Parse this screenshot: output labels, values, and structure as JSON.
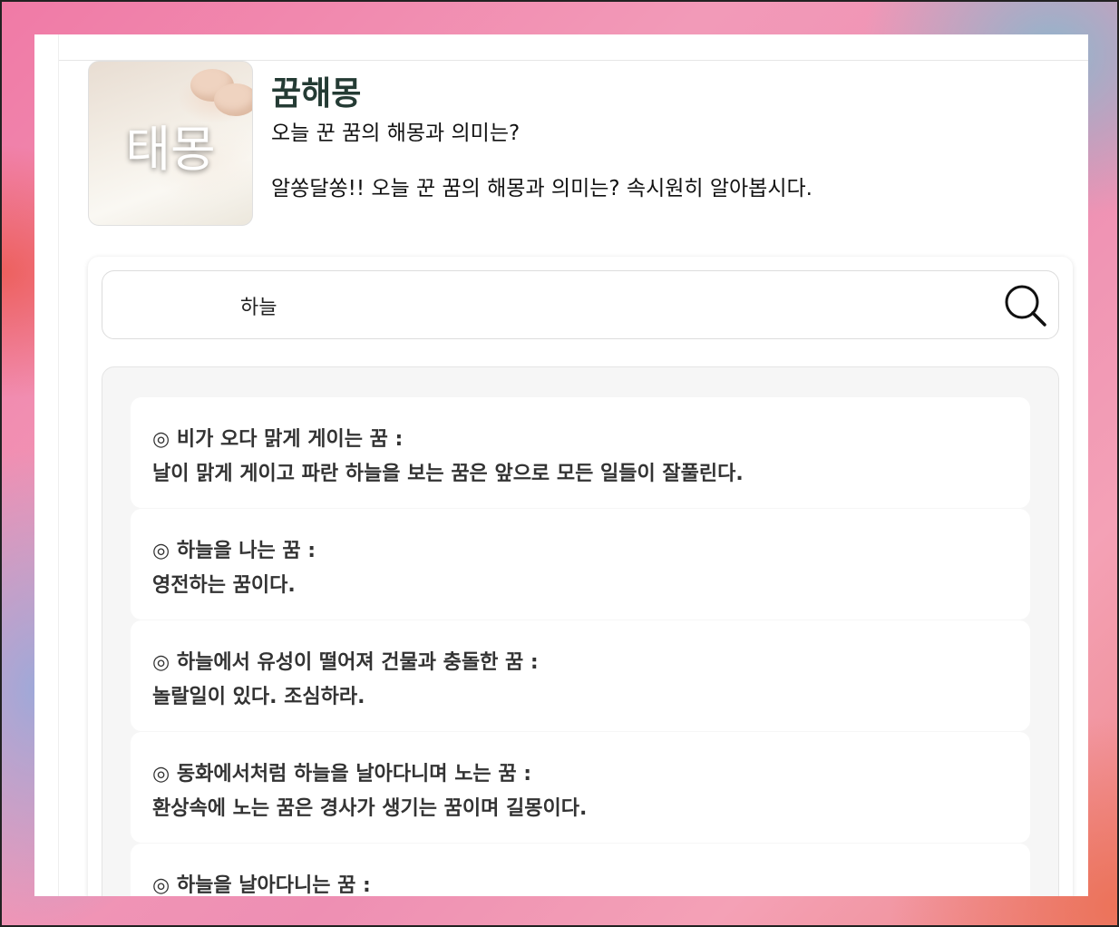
{
  "header": {
    "thumbnail_text": "태몽",
    "title": "꿈해몽",
    "subtitle": "오늘 꾼 꿈의 해몽과 의미는?",
    "description": "알쏭달쏭!! 오늘 꾼 꿈의 해몽과 의미는? 속시원히 알아봅시다."
  },
  "search": {
    "value": "하늘",
    "icon": "search-icon"
  },
  "results": [
    {
      "title": "◎ 비가 오다 맑게 게이는 꿈 :",
      "body": "날이 맑게 게이고 파란 하늘을 보는 꿈은 앞으로 모든 일들이 잘풀린다."
    },
    {
      "title": "◎ 하늘을 나는 꿈 :",
      "body": "영전하는 꿈이다."
    },
    {
      "title": "◎ 하늘에서 유성이 떨어져 건물과 충돌한 꿈 :",
      "body": "놀랄일이 있다. 조심하라."
    },
    {
      "title": "◎ 동화에서처럼 하늘을 날아다니며 노는 꿈 :",
      "body": "환상속에 노는 꿈은 경사가 생기는 꿈이며 길몽이다."
    },
    {
      "title": "◎ 하늘을 날아다니는 꿈 :",
      "body": ""
    }
  ]
}
